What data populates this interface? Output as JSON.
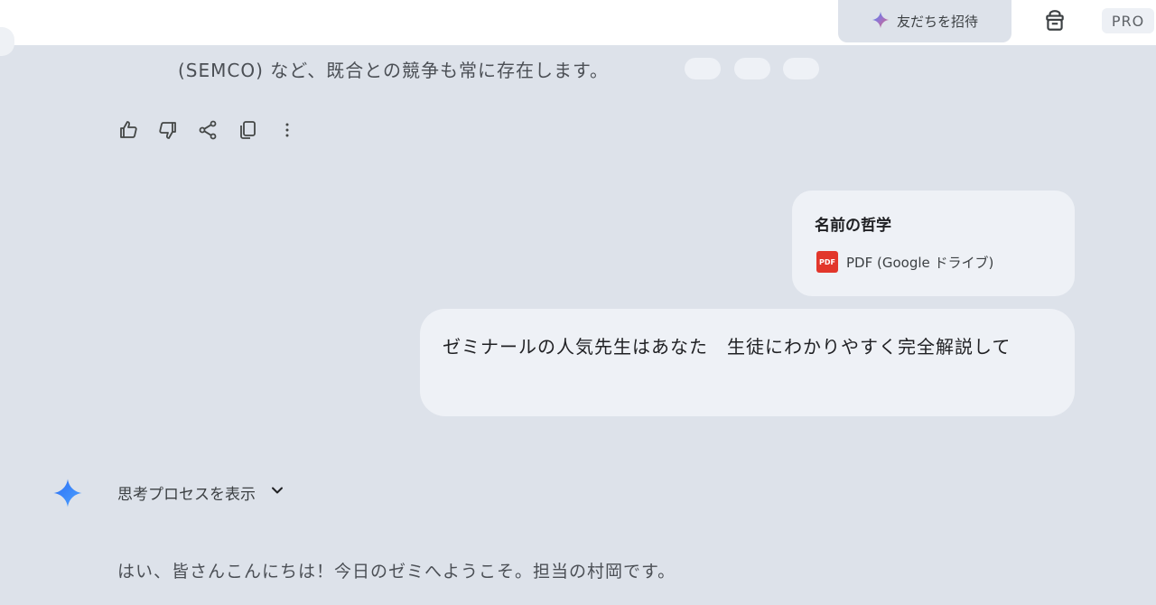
{
  "header": {
    "invite_label": "友だちを招待",
    "plan_badge": "PRO",
    "icons": {
      "invite": "sparkle-icon",
      "bag": "shopping-bag-icon"
    }
  },
  "previous_message": {
    "partial_text": "(SEMCO) など、既合との競争も常に存在します。"
  },
  "actions": [
    "thumbs-up-icon",
    "thumbs-down-icon",
    "share-icon",
    "copy-icon",
    "more-vert-icon"
  ],
  "attachment": {
    "title": "名前の哲学",
    "file_type": "PDF (Google ドライブ)",
    "icon": "pdf-icon",
    "icon_color": "#e2362b"
  },
  "user_prompt": {
    "text": "ゼミナールの人気先生はあなた　生徒にわかりやすく完全解説して"
  },
  "response": {
    "thinking_label": "思考プロセスを表示",
    "first_line": "はい、皆さんこんにちは！今日のゼミへようこそ。担当の村岡です。",
    "avatar_icon": "gemini-spark-icon",
    "accent": "#3b82f6"
  }
}
